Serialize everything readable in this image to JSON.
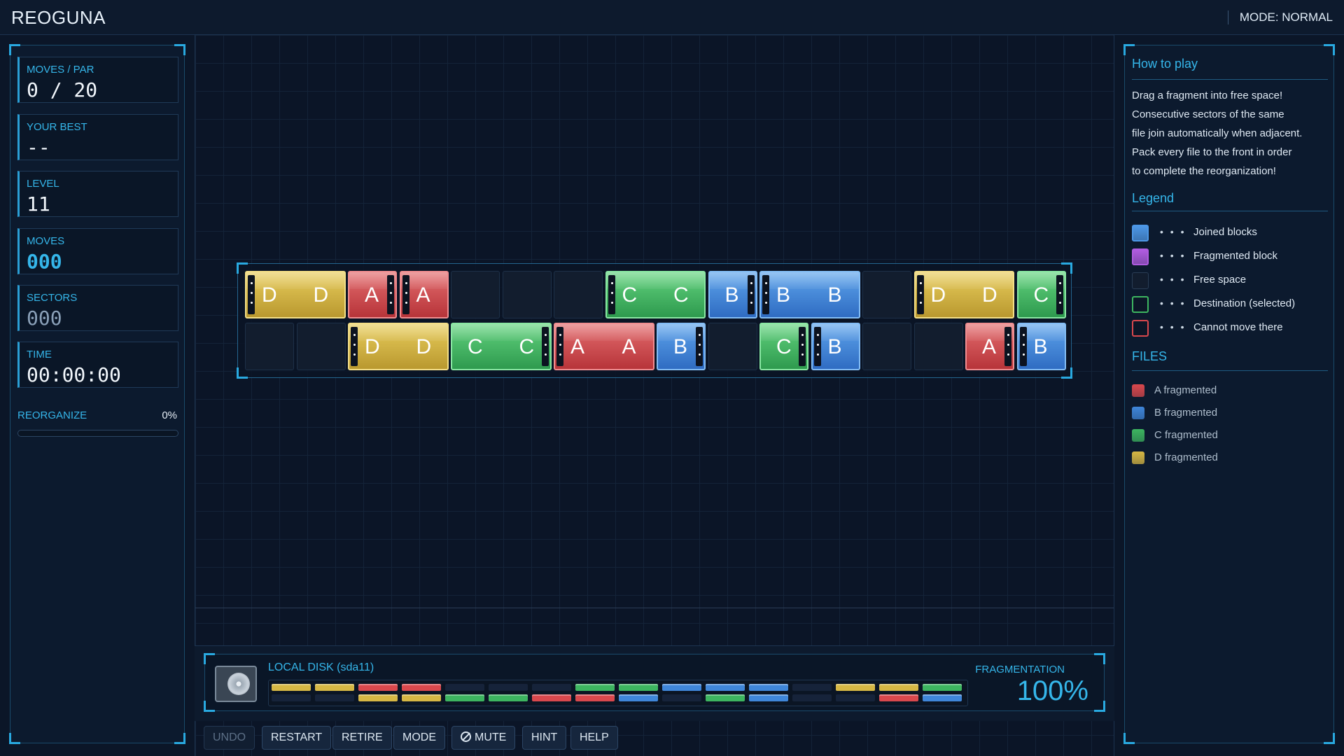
{
  "app": {
    "title": "REOGUNA",
    "mode_label": "MODE: NORMAL"
  },
  "stats": {
    "moves_par_label": "MOVES / PAR",
    "moves_par_value": "0 / 20",
    "best_label": "YOUR BEST",
    "best_value": "--",
    "level_label": "LEVEL",
    "level_value": "11",
    "moves_label": "MOVES",
    "moves_value": "000",
    "sectors_label": "SECTORS",
    "sectors_value": "000",
    "time_label": "TIME",
    "time_value": "00:00:00"
  },
  "reorganize": {
    "label": "REORGANIZE",
    "percent_text": "0%",
    "progress": 0
  },
  "colors": {
    "A": "#d9484d",
    "B": "#3f86d9",
    "C": "#3db560",
    "D": "#d6b744",
    "accent": "#35b6ea",
    "purple": "#a454d8"
  },
  "board": {
    "row1": [
      {
        "file": "D",
        "span": 2,
        "labels": [
          "D",
          "D"
        ]
      },
      {
        "file": "A",
        "span": 1,
        "labels": [
          "A"
        ]
      },
      {
        "file": "A",
        "span": 1,
        "labels": [
          "A"
        ]
      },
      {
        "file": null,
        "span": 1
      },
      {
        "file": null,
        "span": 1
      },
      {
        "file": null,
        "span": 1
      },
      {
        "file": "C",
        "span": 2,
        "labels": [
          "C",
          "C"
        ]
      },
      {
        "file": "B",
        "span": 1,
        "labels": [
          "B"
        ]
      },
      {
        "file": "B",
        "span": 2,
        "labels": [
          "B",
          "B"
        ]
      },
      {
        "file": null,
        "span": 1
      },
      {
        "file": "D",
        "span": 2,
        "labels": [
          "D",
          "D"
        ]
      },
      {
        "file": "C",
        "span": 1,
        "labels": [
          "C"
        ]
      }
    ],
    "row2": [
      {
        "file": null,
        "span": 1
      },
      {
        "file": null,
        "span": 1
      },
      {
        "file": "D",
        "span": 2,
        "labels": [
          "D",
          "D"
        ]
      },
      {
        "file": "C",
        "span": 2,
        "labels": [
          "C",
          "C"
        ]
      },
      {
        "file": "A",
        "span": 2,
        "labels": [
          "A",
          "A"
        ]
      },
      {
        "file": "B",
        "span": 1,
        "labels": [
          "B"
        ]
      },
      {
        "file": null,
        "span": 1
      },
      {
        "file": "C",
        "span": 1,
        "labels": [
          "C"
        ]
      },
      {
        "file": "B",
        "span": 1,
        "labels": [
          "B"
        ]
      },
      {
        "file": null,
        "span": 1
      },
      {
        "file": null,
        "span": 1
      },
      {
        "file": "A",
        "span": 1,
        "labels": [
          "A"
        ]
      },
      {
        "file": "B",
        "span": 1,
        "labels": [
          "B"
        ]
      }
    ]
  },
  "disk": {
    "title": "LOCAL DISK (sda11)",
    "fragmentation_label": "FRAGMENTATION",
    "fragmentation_value": "100%",
    "row1": [
      "D",
      "D",
      "A",
      "A",
      null,
      null,
      null,
      "C",
      "C",
      "B",
      "B",
      "B",
      null,
      "D",
      "D",
      "C"
    ],
    "row2": [
      null,
      null,
      "D",
      "D",
      "C",
      "C",
      "A",
      "A",
      "B",
      null,
      "C",
      "B",
      null,
      null,
      "A",
      "B"
    ]
  },
  "buttons": {
    "undo": "UNDO",
    "restart": "RESTART",
    "retire": "RETIRE",
    "mode": "MODE",
    "mute": "MUTE",
    "hint": "HINT",
    "help": "HELP"
  },
  "howto": {
    "title": "How to play",
    "lines": [
      "Drag a fragment into free space!",
      "Consecutive sectors of the same",
      "file join automatically when adjacent.",
      "Pack every file to the front in order",
      "to complete the reorganization!"
    ]
  },
  "legend": {
    "title": "Legend",
    "items": [
      {
        "name": "joined",
        "label": "Joined blocks",
        "color": "#4d97e6"
      },
      {
        "name": "fragmented",
        "label": "Fragmented block",
        "color": "#b05ce0"
      },
      {
        "name": "free",
        "label": "Free space",
        "color": "#121d2e"
      },
      {
        "name": "destination",
        "label": "Destination (selected)",
        "color": "#3db560"
      },
      {
        "name": "cannot-move",
        "label": "Cannot move there",
        "color": "#d9484d"
      }
    ]
  },
  "files": {
    "title": "FILES",
    "items": [
      {
        "file": "A",
        "label": "fragmented",
        "color": "#d9484d"
      },
      {
        "file": "B",
        "label": "fragmented",
        "color": "#3f86d9"
      },
      {
        "file": "C",
        "label": "fragmented",
        "color": "#3db560"
      },
      {
        "file": "D",
        "label": "fragmented",
        "color": "#d6b744"
      }
    ]
  }
}
